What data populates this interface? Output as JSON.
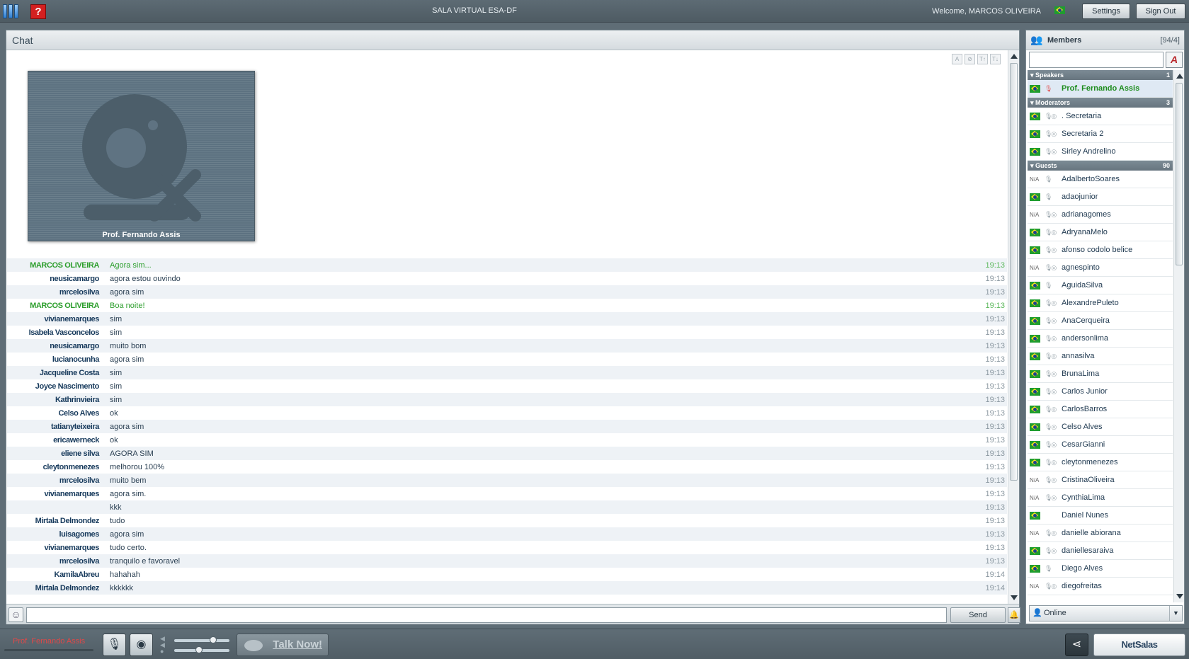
{
  "app": {
    "title": "SALA VIRTUAL ESA-DF",
    "welcome": "Welcome, MARCOS OLIVEIRA",
    "settings_label": "Settings",
    "signout_label": "Sign Out",
    "help_label": "?"
  },
  "chat": {
    "title": "Chat",
    "video_name": "Prof. Fernando Assis",
    "tools": [
      "A",
      "⊘",
      "T↑",
      "T↓"
    ],
    "messages": [
      {
        "author": "MARCOS OLIVEIRA",
        "text": "Agora sim...",
        "time": "19:13",
        "self": true
      },
      {
        "author": "neusicamargo",
        "text": "agora estou ouvindo",
        "time": "19:13",
        "self": false
      },
      {
        "author": "mrcelosilva",
        "text": "agora sim",
        "time": "19:13",
        "self": false
      },
      {
        "author": "MARCOS OLIVEIRA",
        "text": "Boa noite!",
        "time": "19:13",
        "self": true
      },
      {
        "author": "vivianemarques",
        "text": "sim",
        "time": "19:13",
        "self": false
      },
      {
        "author": "Isabela Vasconcelos",
        "text": "sim",
        "time": "19:13",
        "self": false
      },
      {
        "author": "neusicamargo",
        "text": "muito bom",
        "time": "19:13",
        "self": false
      },
      {
        "author": "lucianocunha",
        "text": "agora sim",
        "time": "19:13",
        "self": false
      },
      {
        "author": "Jacqueline Costa",
        "text": "sim",
        "time": "19:13",
        "self": false
      },
      {
        "author": "Joyce Nascimento",
        "text": "sim",
        "time": "19:13",
        "self": false
      },
      {
        "author": "Kathrinvieira",
        "text": "sim",
        "time": "19:13",
        "self": false
      },
      {
        "author": "Celso Alves",
        "text": "ok",
        "time": "19:13",
        "self": false
      },
      {
        "author": "tatianyteixeira",
        "text": "agora sim",
        "time": "19:13",
        "self": false
      },
      {
        "author": "ericawerneck",
        "text": "ok",
        "time": "19:13",
        "self": false
      },
      {
        "author": "eliene silva",
        "text": "AGORA SIM",
        "time": "19:13",
        "self": false
      },
      {
        "author": "cleytonmenezes",
        "text": "melhorou 100%",
        "time": "19:13",
        "self": false
      },
      {
        "author": "mrcelosilva",
        "text": "muito bem",
        "time": "19:13",
        "self": false
      },
      {
        "author": "vivianemarques",
        "text": "agora sim.",
        "time": "19:13",
        "self": false
      },
      {
        "author": "",
        "text": "kkk",
        "time": "19:13",
        "self": false
      },
      {
        "author": "Mirtala Delmondez",
        "text": "tudo",
        "time": "19:13",
        "self": false
      },
      {
        "author": "luisagomes",
        "text": "agora sim",
        "time": "19:13",
        "self": false
      },
      {
        "author": "vivianemarques",
        "text": "tudo certo.",
        "time": "19:13",
        "self": false
      },
      {
        "author": "mrcelosilva",
        "text": "tranquilo e favoravel",
        "time": "19:13",
        "self": false
      },
      {
        "author": "KamilaAbreu",
        "text": "hahahah",
        "time": "19:14",
        "self": false
      },
      {
        "author": "Mirtala Delmondez",
        "text": "kkkkkk",
        "time": "19:14",
        "self": false
      }
    ],
    "input_value": "",
    "send_label": "Send"
  },
  "members": {
    "title": "Members",
    "count": "[94/4]",
    "search_value": "",
    "az_label": "A",
    "groups": [
      {
        "name": "Speakers",
        "count": "1",
        "members": [
          {
            "name": "Prof. Fernando Assis",
            "status": "flag",
            "icons": "🎙",
            "speaker": true,
            "highlight": true
          }
        ]
      },
      {
        "name": "Moderators",
        "count": "3",
        "members": [
          {
            "name": ". Secretaria",
            "status": "flag",
            "icons": "🎙◎"
          },
          {
            "name": "Secretaria 2",
            "status": "flag",
            "icons": "🎙◎"
          },
          {
            "name": "Sirley Andrelino",
            "status": "flag",
            "icons": "🎙◎"
          }
        ]
      },
      {
        "name": "Guests",
        "count": "90",
        "members": [
          {
            "name": "AdalbertoSoares",
            "status": "N/A",
            "icons": "🎙"
          },
          {
            "name": "adaojunior",
            "status": "flag",
            "icons": "🎙"
          },
          {
            "name": "adrianagomes",
            "status": "N/A",
            "icons": "🎙◎"
          },
          {
            "name": "AdryanaMelo",
            "status": "flag",
            "icons": "🎙◎"
          },
          {
            "name": "afonso codolo belice",
            "status": "flag",
            "icons": "🎙◎"
          },
          {
            "name": "agnespinto",
            "status": "N/A",
            "icons": "🎙◎"
          },
          {
            "name": "AguidaSilva",
            "status": "flag",
            "icons": "🎙"
          },
          {
            "name": "AlexandrePuleto",
            "status": "flag",
            "icons": "🎙◎"
          },
          {
            "name": "AnaCerqueira",
            "status": "flag",
            "icons": "🎙◎"
          },
          {
            "name": "andersonlima",
            "status": "flag",
            "icons": "🎙◎"
          },
          {
            "name": "annasilva",
            "status": "flag",
            "icons": "🎙◎"
          },
          {
            "name": "BrunaLima",
            "status": "flag",
            "icons": "🎙◎"
          },
          {
            "name": "Carlos Junior",
            "status": "flag",
            "icons": "🎙◎"
          },
          {
            "name": "CarlosBarros",
            "status": "flag",
            "icons": "🎙◎"
          },
          {
            "name": "Celso Alves",
            "status": "flag",
            "icons": "🎙◎"
          },
          {
            "name": "CesarGianni",
            "status": "flag",
            "icons": "🎙◎"
          },
          {
            "name": "cleytonmenezes",
            "status": "flag",
            "icons": "🎙◎"
          },
          {
            "name": "CristinaOliveira",
            "status": "N/A",
            "icons": "🎙◎"
          },
          {
            "name": "CynthiaLima",
            "status": "N/A",
            "icons": "🎙◎"
          },
          {
            "name": "Daniel Nunes",
            "status": "flag",
            "icons": ""
          },
          {
            "name": "danielle abiorana",
            "status": "N/A",
            "icons": "🎙◎"
          },
          {
            "name": "daniellesaraiva",
            "status": "flag",
            "icons": "🎙◎"
          },
          {
            "name": "Diego Alves",
            "status": "flag",
            "icons": "🎙"
          },
          {
            "name": "diegofreitas",
            "status": "N/A",
            "icons": "🎙◎"
          }
        ]
      }
    ],
    "status_label": "Online"
  },
  "bottom": {
    "speaker_name": "Prof. Fernando Assis",
    "talk_label": "Talk Now!",
    "brand_label": "NetSalas"
  },
  "colors": {
    "self_message": "#2c9e2c",
    "speaker_name": "#e04848",
    "group_header": "#6f7e88"
  }
}
